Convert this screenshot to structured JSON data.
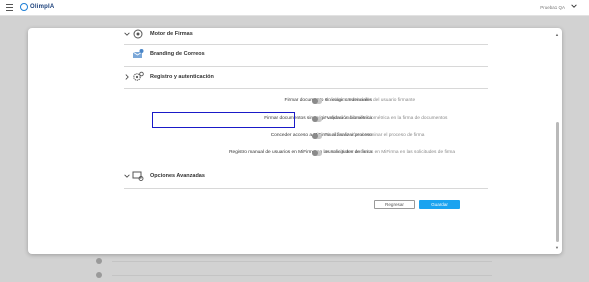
{
  "header": {
    "brand": "OlimpIA",
    "user": "Prueba1 QA",
    "brand_color": "#1f7fd6",
    "menu_icon": "hamburger-icon",
    "user_menu_icon": "chevron-down-icon"
  },
  "sections": [
    {
      "title": "Motor de Firmas",
      "icon": "signature-engine-icon"
    },
    {
      "title": "Branding de Correos",
      "icon": "email-branding-icon"
    },
    {
      "title": "Registro y autenticación",
      "icon": "gears-icon"
    },
    {
      "title": "Opciones Avanzadas",
      "icon": "advanced-options-icon"
    }
  ],
  "settings": [
    {
      "label": "Firmar documento sin exigir credenciales",
      "description": "Solicitar autenticación del usuario firmante",
      "enabled": false
    },
    {
      "label": "Firmar documentos sin exigir validación biométrica",
      "description": "Requerir validación biométrica en la firma de documentos",
      "enabled": false
    },
    {
      "label": "Conceder acceso a MiFirma al finalizar proceso",
      "description": "Finalizar sesión al terminar el proceso de firma",
      "enabled": false
    },
    {
      "label": "Registro manual de usuarios en MiFirma en las solicitudes de firma",
      "description": "Auto registrar usuarios en MiFirma en las solicitudes de firma",
      "enabled": false
    }
  ],
  "actions": {
    "secondary": "Regresar",
    "primary": "Guardar",
    "primary_color": "#1aa3f0"
  },
  "highlight_color": "#1a1ac8"
}
